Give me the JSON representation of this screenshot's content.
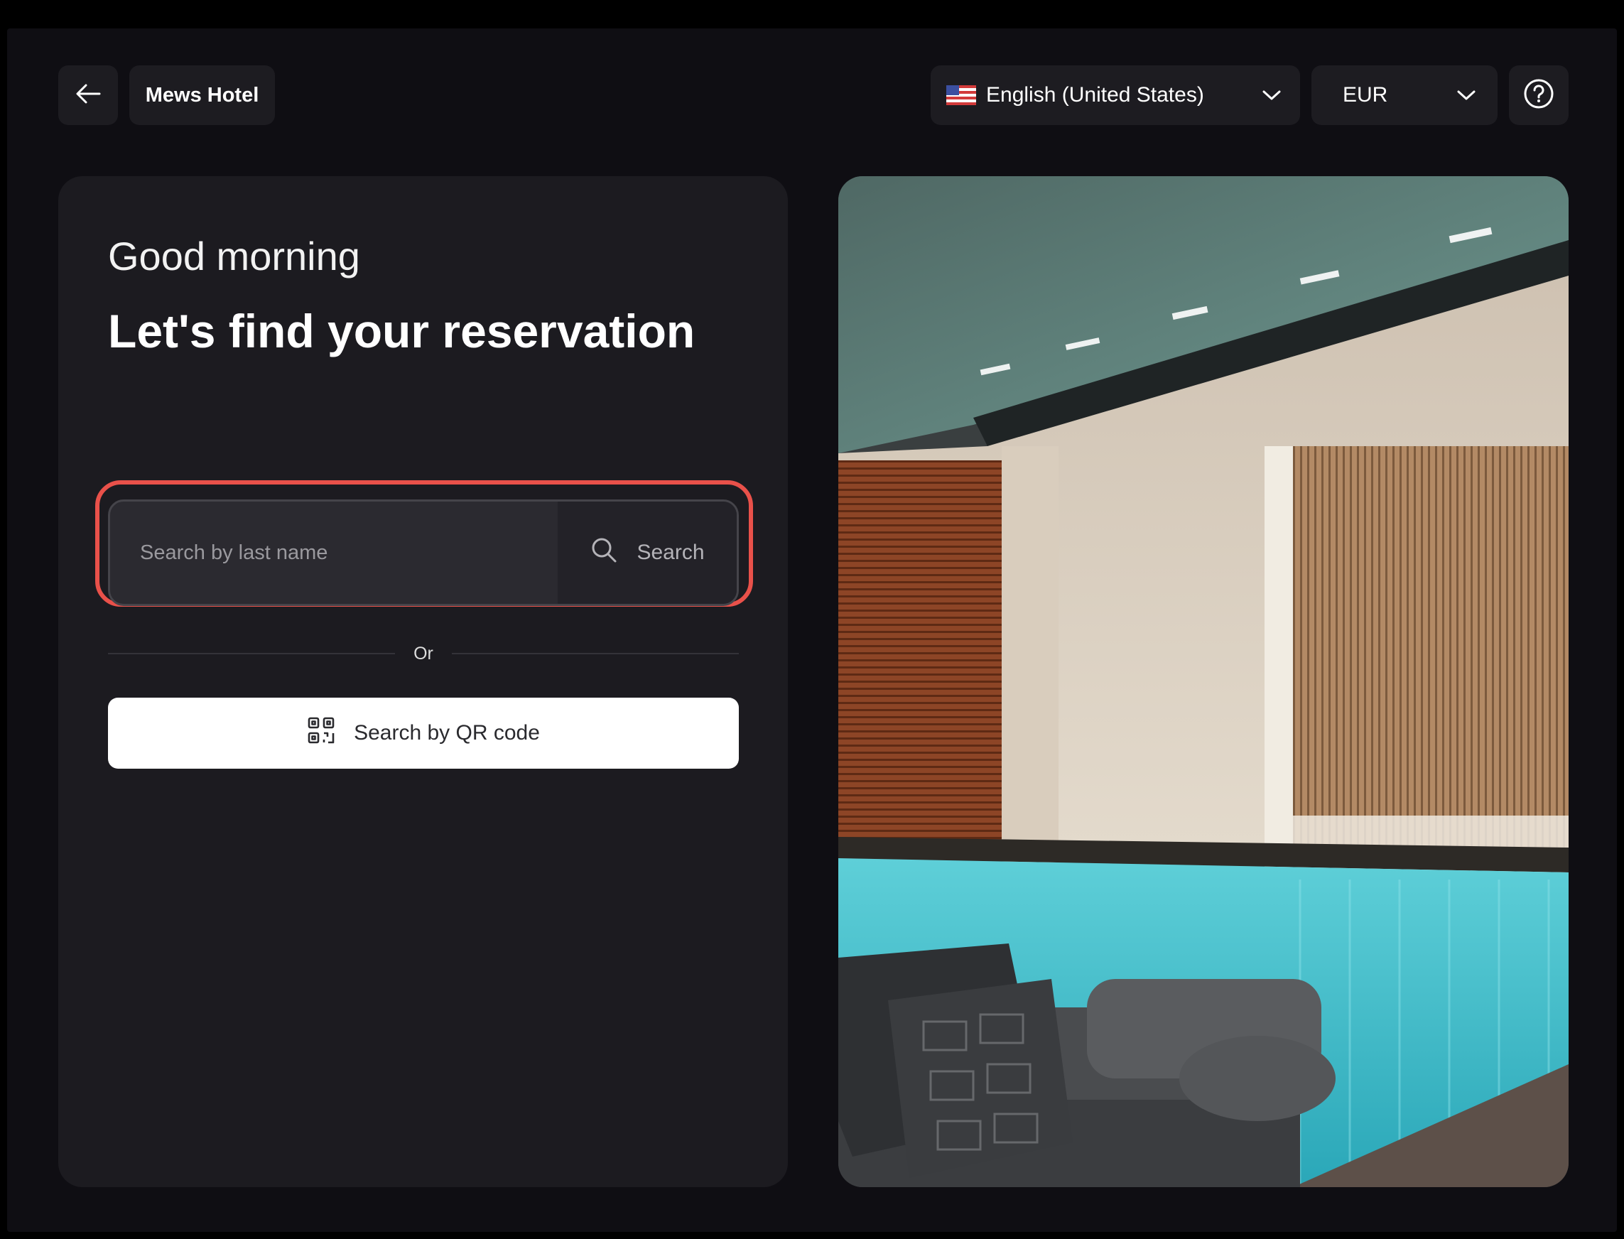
{
  "header": {
    "back_icon": "arrow-left-icon",
    "hotel_name": "Mews Hotel",
    "language": {
      "flag_icon": "us-flag-icon",
      "selected": "English (United States)"
    },
    "currency": {
      "selected": "EUR"
    },
    "help_icon": "help-circle-icon"
  },
  "main": {
    "greeting": "Good morning",
    "title": "Let's find your reservation",
    "search": {
      "placeholder": "Search by last name",
      "value": "",
      "button_label": "Search",
      "button_icon": "magnifier-icon"
    },
    "divider_label": "Or",
    "qr_button": {
      "label": "Search by QR code",
      "icon": "qr-code-icon"
    }
  },
  "hero_image": {
    "description_icon": "hotel-pool-photo"
  },
  "colors": {
    "background": "#0f0e13",
    "card": "#1c1b20",
    "highlight": "#e9514a",
    "qr_button_bg": "#ffffff"
  }
}
